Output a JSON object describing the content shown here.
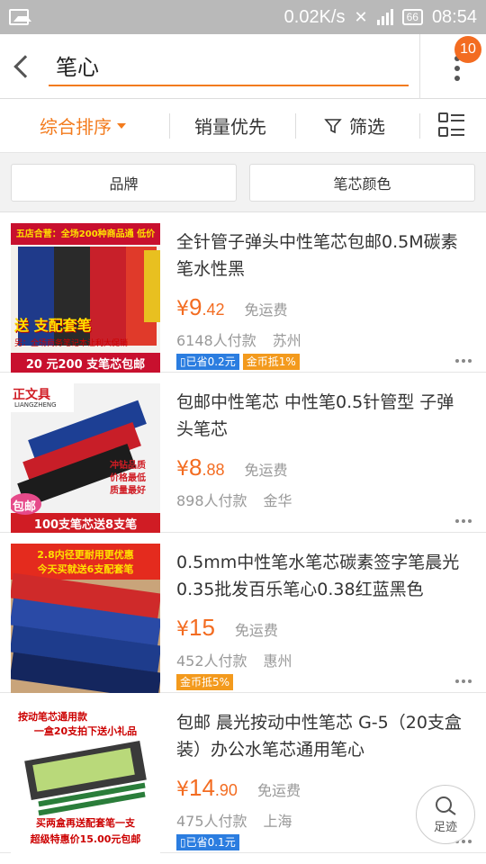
{
  "status_bar": {
    "speed": "0.02K/s",
    "battery": "66",
    "time": "08:54"
  },
  "search": {
    "query": "笔心",
    "badge_count": "10"
  },
  "sort_bar": {
    "comprehensive": "综合排序",
    "sales_first": "销量优先",
    "filter": "筛选"
  },
  "filters": {
    "brand": "品牌",
    "refill_color": "笔芯颜色"
  },
  "products": [
    {
      "title": "全针管子弹头中性笔芯包邮0.5M碳素笔水性黑",
      "price_symbol": "¥",
      "price_int": "9",
      "price_dec": ".42",
      "shipping": "免运费",
      "buyers": "6148人付款",
      "location": "苏州",
      "tag_save": "已省0.2元",
      "tag_coin": "金币抵1%",
      "image_text": {
        "top": "五店合营：全场200种商品通  低价",
        "mid": "送  支配套笔",
        "note": "另：全场商务笔记本让利大促销",
        "bottom": "20 元200 支笔芯包邮"
      }
    },
    {
      "title": "包邮中性笔芯 中性笔0.5针管型 子弹头笔芯",
      "price_symbol": "¥",
      "price_int": "8",
      "price_dec": ".88",
      "shipping": "免运费",
      "buyers": "898人付款",
      "location": "金华",
      "image_text": {
        "brand": "正文具",
        "brand_en": "LIANGZHENG",
        "promo1": "冲钻品质",
        "promo2": "价格最低",
        "promo3": "质量最好",
        "bottom": "100支笔芯送8支笔",
        "free": "包邮"
      }
    },
    {
      "title": "0.5mm中性笔水笔芯碳素签字笔晨光0.35批发百乐笔心0.38红蓝黑色",
      "price_symbol": "¥",
      "price_int": "15",
      "price_dec": "",
      "shipping": "免运费",
      "buyers": "452人付款",
      "location": "惠州",
      "tag_coin": "金币抵5%",
      "image_text": {
        "line1": "2.8内径更耐用更优惠",
        "line2": "今天买就送6支配套笔"
      }
    },
    {
      "title": "包邮 晨光按动中性笔芯 G-5（20支盒装）办公水笔芯通用笔心",
      "price_symbol": "¥",
      "price_int": "14",
      "price_dec": ".90",
      "shipping": "免运费",
      "buyers": "475人付款",
      "location": "上海",
      "tag_save": "已省0.1元",
      "image_text": {
        "line1": "按动笔芯通用款",
        "line2": "一盒20支拍下送小礼品",
        "line3": "买两盒再送配套笔一支",
        "line4": "超级特惠价15.00元包邮"
      }
    }
  ],
  "float_button": {
    "label": "足迹"
  },
  "colors": {
    "accent": "#f36c21",
    "status_bar": "#b9b9b9",
    "tag_blue": "#2b7de0",
    "tag_orange": "#f39a1d"
  }
}
